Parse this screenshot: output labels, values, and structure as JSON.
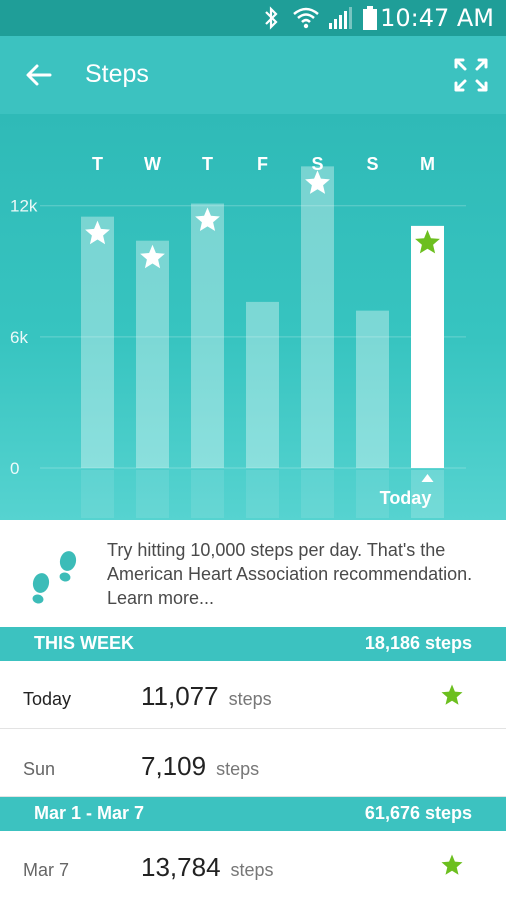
{
  "status_bar": {
    "time": "10:47 AM"
  },
  "app_bar": {
    "title": "Steps",
    "back_icon": "arrow-back-icon",
    "expand_icon": "expand-icon"
  },
  "chart_data": {
    "type": "bar",
    "categories": [
      "T",
      "W",
      "T",
      "F",
      "S",
      "S",
      "M"
    ],
    "values": [
      11500,
      10400,
      12100,
      7600,
      13800,
      7200,
      11077
    ],
    "goal_met": [
      true,
      true,
      true,
      false,
      true,
      false,
      true
    ],
    "highlight_index": 6,
    "y_ticks": [
      "0",
      "6k",
      "12k"
    ],
    "y_tick_values": [
      0,
      6000,
      12000
    ],
    "ylim": [
      0,
      14000
    ],
    "today_label": "Today",
    "colors": {
      "bar": "rgba(255,255,255,0.35)",
      "today_bar": "#ffffff",
      "star": "#ffffff",
      "today_star": "#6cbf1f"
    }
  },
  "tip": {
    "text": "Try hitting 10,000 steps per day. That's the American Heart Association recommendation. Learn more...",
    "icon": "footsteps-icon"
  },
  "this_week": {
    "label": "THIS WEEK",
    "total": "18,186 steps",
    "rows": [
      {
        "date": "Today",
        "value": "11,077",
        "unit": "steps",
        "goal_star": true
      },
      {
        "date": "Sun",
        "value": "7,109",
        "unit": "steps",
        "goal_star": false
      }
    ]
  },
  "prev_week": {
    "label": "Mar 1 - Mar 7",
    "total": "61,676 steps",
    "rows": [
      {
        "date": "Mar 7",
        "value": "13,784",
        "unit": "steps",
        "goal_star": true
      }
    ]
  },
  "colors": {
    "teal": "#3cc2c0",
    "teal_dark": "#1f9e98",
    "goal_green": "#6cbf1f"
  }
}
